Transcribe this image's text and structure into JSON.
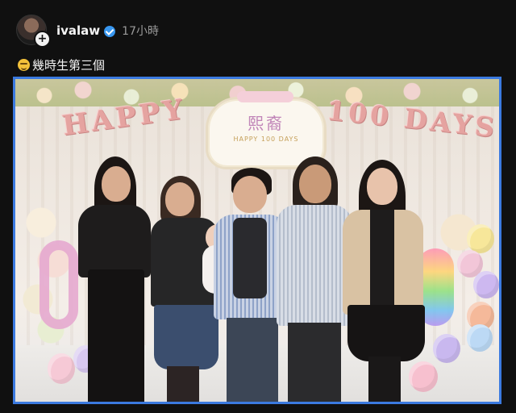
{
  "post": {
    "username": "ivalaw",
    "time": "17小時",
    "caption": "幾時生第三個",
    "follow_plus": "+"
  },
  "photo": {
    "banner_left": "HAPPY",
    "banner_right": "100 DAYS",
    "sign_title": "熙裔",
    "sign_sub": "HAPPY 100 DAYS"
  },
  "colors": {
    "background": "#101010",
    "accent_border": "#3b7ae0",
    "verified": "#3897f0"
  }
}
